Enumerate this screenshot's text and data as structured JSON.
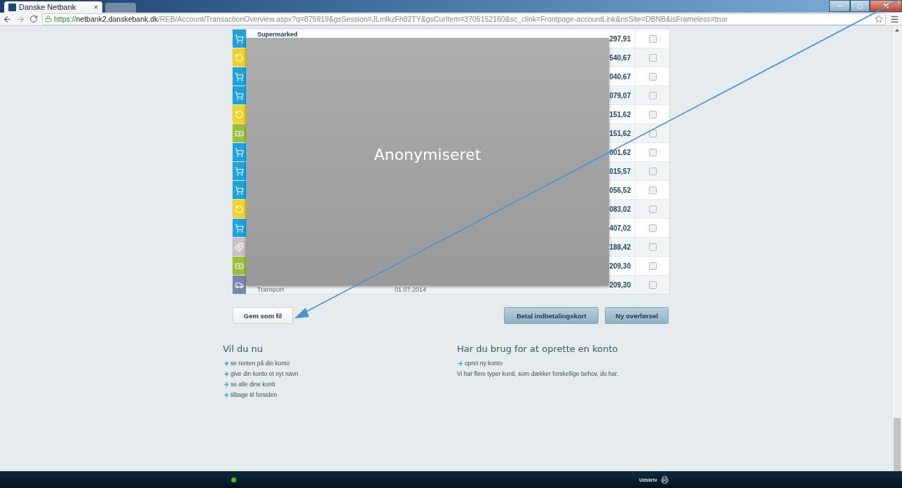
{
  "browser": {
    "tab": {
      "title": "Danske Netbank",
      "close": "×"
    },
    "url": {
      "scheme": "https://",
      "host": "netbank2.danskebank.dk",
      "path": "/REB/Account/TransactionOverview.aspx?q=875919&gsSession=JLmlkzFh82TY&gsCurItem=3705152160&sc_clink=Frontpage-accountLink&nsSite=DBNB&isFrameless=true"
    }
  },
  "transactions": [
    {
      "kind": "cart",
      "category": "Supermarked",
      "amount": "297,91",
      "checked": false
    },
    {
      "kind": "refresh",
      "amount": "540,67",
      "checked": false
    },
    {
      "kind": "cart",
      "amount": "040,67",
      "checked": false
    },
    {
      "kind": "cart",
      "amount": "079,07",
      "checked": false
    },
    {
      "kind": "refresh",
      "amount": "151,62",
      "checked": false
    },
    {
      "kind": "money",
      "amount": "151,62",
      "checked": false
    },
    {
      "kind": "cart",
      "amount": "001,62",
      "checked": false
    },
    {
      "kind": "cart",
      "amount": "015,57",
      "checked": false
    },
    {
      "kind": "cart",
      "amount": "056,52",
      "checked": false
    },
    {
      "kind": "refresh",
      "amount": "083,02",
      "checked": false
    },
    {
      "kind": "cart",
      "amount": "407,02",
      "checked": false
    },
    {
      "kind": "masks",
      "amount": "188,42",
      "checked": false
    },
    {
      "kind": "money",
      "amount": "209,30",
      "checked": false
    },
    {
      "kind": "car",
      "subcategory": "Transport",
      "date": "01.07.2014",
      "amount": "209,30",
      "checked": false
    }
  ],
  "redaction": {
    "label": "Anonymiseret"
  },
  "buttons": [
    {
      "label": "Gem som fil",
      "kind": "plain"
    },
    {
      "label": "Betal indbetalingskort",
      "kind": "primary"
    },
    {
      "label": "Ny overførsel",
      "kind": "primary"
    }
  ],
  "sections": [
    {
      "heading": "Vil du nu",
      "links": [
        "se renten på din konto",
        "give din konto et nyt navn",
        "se alle dine konti",
        "tilbage til forsiden"
      ]
    },
    {
      "heading": "Har du brug for at oprette en konto",
      "links": [
        "opret ny konto"
      ],
      "text": "Vi har flere typer konti, som dækker forskellige behov, du har."
    }
  ],
  "footer": {
    "print": "Udskriv"
  }
}
